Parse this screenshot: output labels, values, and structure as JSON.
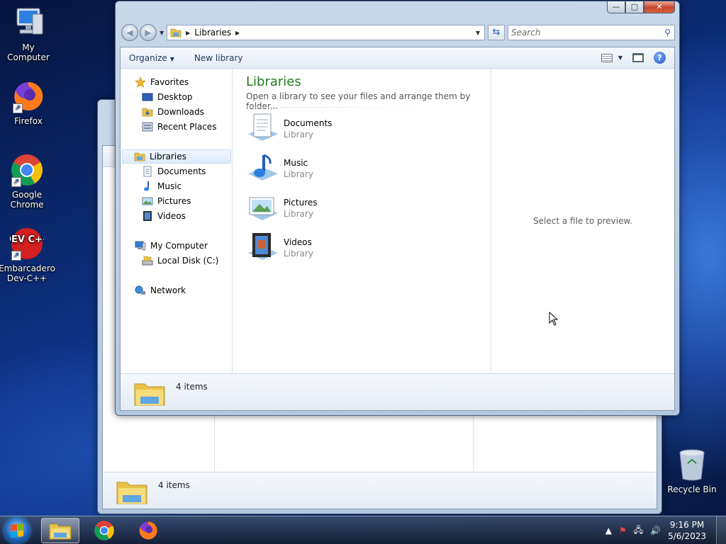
{
  "desktop": {
    "icons": [
      {
        "label": "My Computer"
      },
      {
        "label": "Firefox"
      },
      {
        "label": "Google Chrome"
      },
      {
        "label": "Embarcadero Dev-C++"
      }
    ],
    "devcpp_logo": "DEV C++",
    "recycle_bin": "Recycle Bin"
  },
  "window": {
    "minimize": "—",
    "maximize": "□",
    "close": "✕",
    "address": {
      "crumb": "Libraries"
    },
    "search_placeholder": "Search",
    "toolbar": {
      "organize": "Organize",
      "new_library": "New library"
    },
    "nav": {
      "favorites": "Favorites",
      "desktop": "Desktop",
      "downloads": "Downloads",
      "recent_places": "Recent Places",
      "libraries": "Libraries",
      "documents": "Documents",
      "music": "Music",
      "pictures": "Pictures",
      "videos": "Videos",
      "my_computer": "My Computer",
      "local_disk": "Local Disk (C:)",
      "network": "Network"
    },
    "content": {
      "title": "Libraries",
      "subtitle": "Open a library to see your files and arrange them by folder...",
      "items": [
        {
          "name": "Documents",
          "type": "Library"
        },
        {
          "name": "Music",
          "type": "Library"
        },
        {
          "name": "Pictures",
          "type": "Library"
        },
        {
          "name": "Videos",
          "type": "Library"
        }
      ]
    },
    "preview_message": "Select a file to preview.",
    "details_count": "4 items"
  },
  "back_window": {
    "details_count": "4 items"
  },
  "taskbar": {
    "time": "9:16 PM",
    "date": "5/6/2023"
  },
  "colors": {
    "library_title": "#1e7a1e",
    "close_button": "#c7452b",
    "link_text": "#1e395b"
  }
}
